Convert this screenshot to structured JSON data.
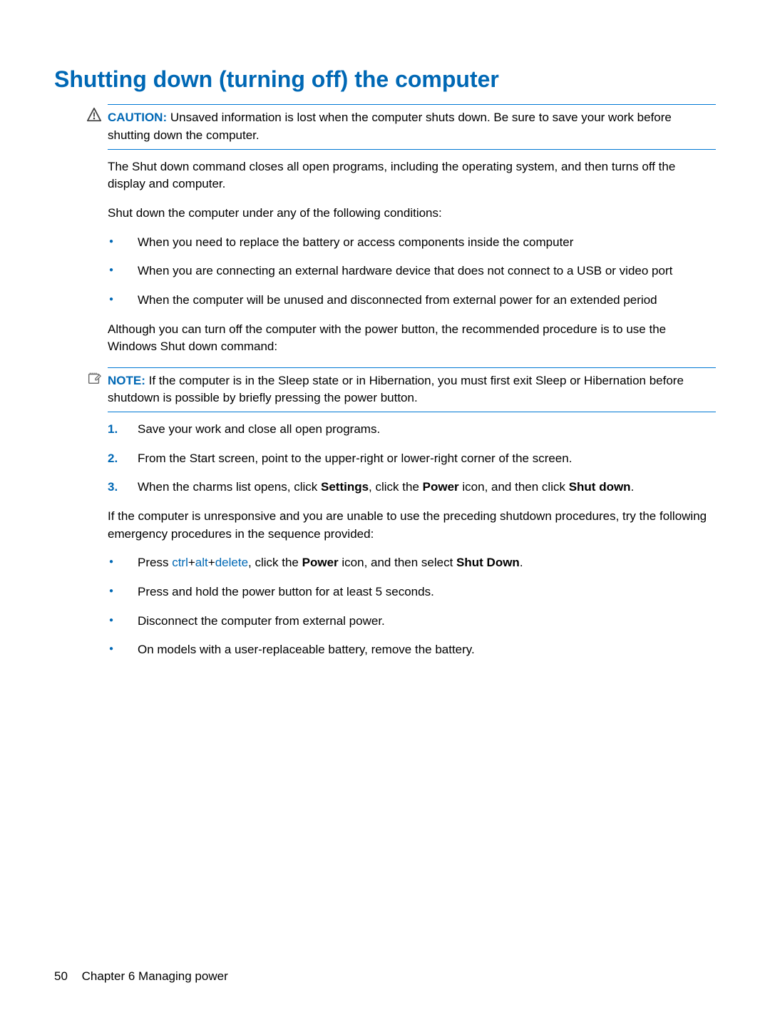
{
  "heading": "Shutting down (turning off) the computer",
  "caution": {
    "label": "CAUTION:",
    "text": "Unsaved information is lost when the computer shuts down. Be sure to save your work before shutting down the computer."
  },
  "intro1": "The Shut down command closes all open programs, including the operating system, and then turns off the display and computer.",
  "intro2": "Shut down the computer under any of the following conditions:",
  "conditions": [
    "When you need to replace the battery or access components inside the computer",
    "When you are connecting an external hardware device that does not connect to a USB or video port",
    "When the computer will be unused and disconnected from external power for an extended period"
  ],
  "rec": "Although you can turn off the computer with the power button, the recommended procedure is to use the Windows Shut down command:",
  "note": {
    "label": "NOTE:",
    "text": "If the computer is in the Sleep state or in Hibernation, you must first exit Sleep or Hibernation before shutdown is possible by briefly pressing the power button."
  },
  "steps": {
    "s1": "Save your work and close all open programs.",
    "s2": "From the Start screen, point to the upper-right or lower-right corner of the screen.",
    "s3_pre": "When the charms list opens, click ",
    "s3_b1": "Settings",
    "s3_mid1": ", click the ",
    "s3_b2": "Power",
    "s3_mid2": " icon, and then click ",
    "s3_b3": "Shut down",
    "s3_post": "."
  },
  "unresp": "If the computer is unresponsive and you are unable to use the preceding shutdown procedures, try the following emergency procedures in the sequence provided:",
  "emerg": {
    "e1_pre": "Press ",
    "e1_k1": "ctrl",
    "e1_plus": "+",
    "e1_k2": "alt",
    "e1_k3": "delete",
    "e1_mid1": ", click the ",
    "e1_b1": "Power",
    "e1_mid2": " icon, and then select ",
    "e1_b2": "Shut Down",
    "e1_post": ".",
    "e2": "Press and hold the power button for at least 5 seconds.",
    "e3": "Disconnect the computer from external power.",
    "e4": "On models with a user-replaceable battery, remove the battery."
  },
  "footer": {
    "page": "50",
    "chapter": "Chapter 6   Managing power"
  }
}
